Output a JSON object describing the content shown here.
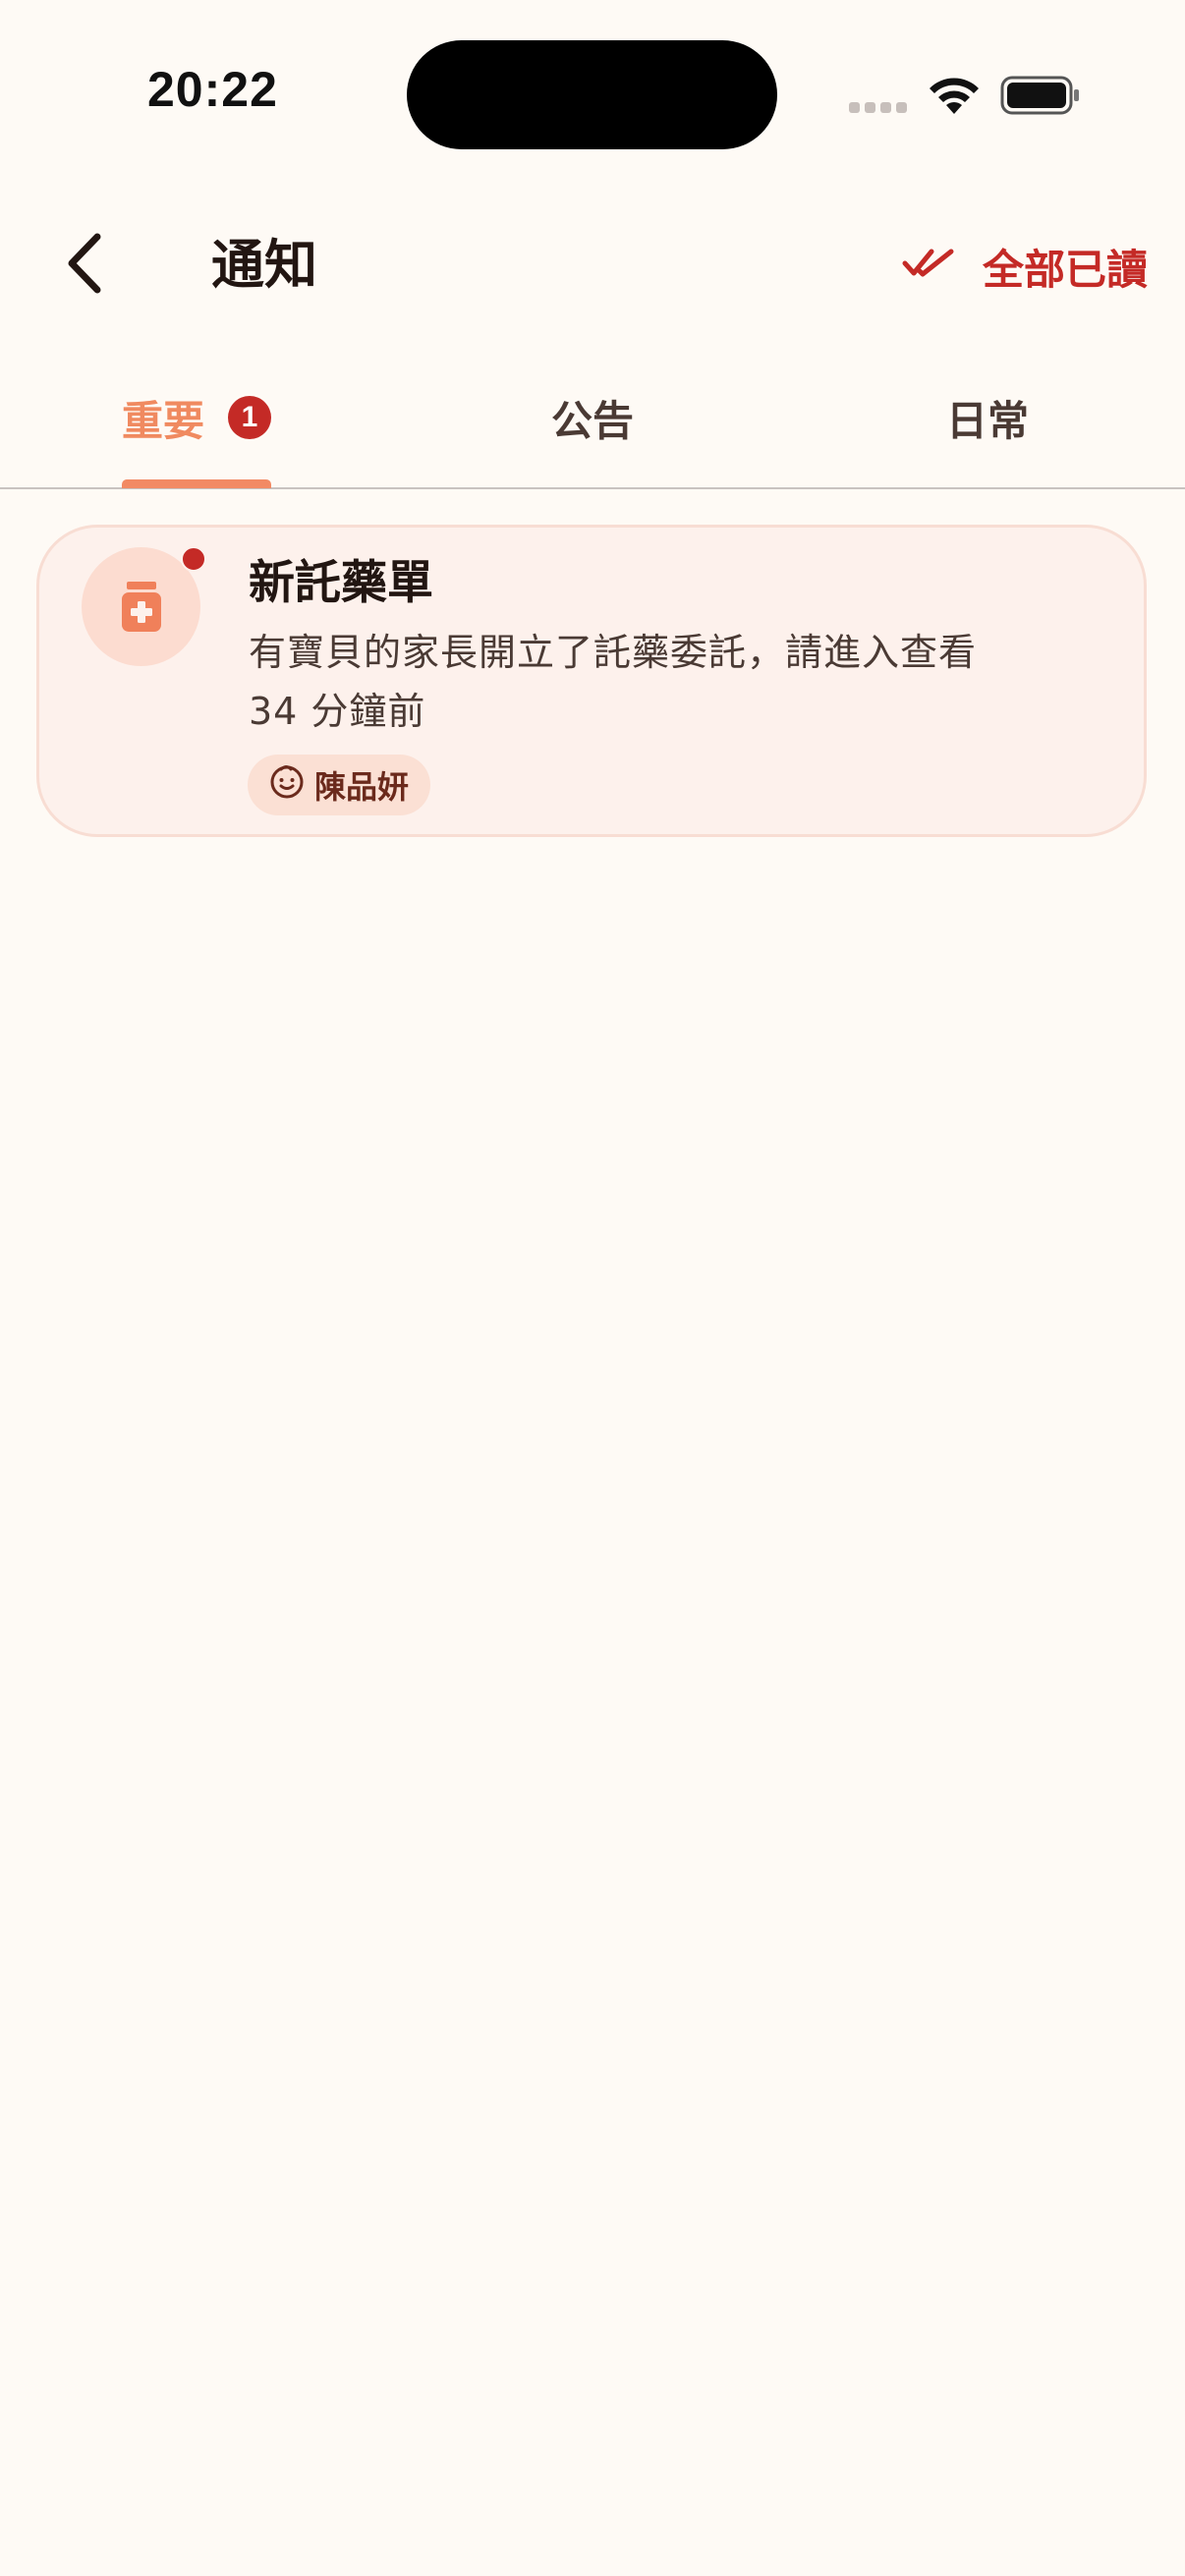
{
  "status_bar": {
    "time": "20:22"
  },
  "header": {
    "title": "通知",
    "mark_all_read_label": "全部已讀",
    "back_icon": "chevron-left-icon",
    "mark_all_icon": "double-check-icon"
  },
  "tabs": [
    {
      "label": "重要",
      "badge": "1",
      "selected": true
    },
    {
      "label": "公告",
      "selected": false
    },
    {
      "label": "日常",
      "selected": false
    }
  ],
  "notifications": [
    {
      "icon": "medicine-jar-icon",
      "unread": true,
      "title": "新託藥單",
      "message": "有寶貝的家長開立了託藥委託，請進入查看",
      "time": "34 分鐘前",
      "child_name": "陳品妍",
      "child_icon": "child-face-icon"
    }
  ],
  "colors": {
    "background": "#fefaf5",
    "accent_red": "#c42a26",
    "accent_orange": "#f28a64",
    "card_background": "#fdf1ec",
    "card_border": "#f8ddd3",
    "tag_background": "#fbe0d4"
  }
}
